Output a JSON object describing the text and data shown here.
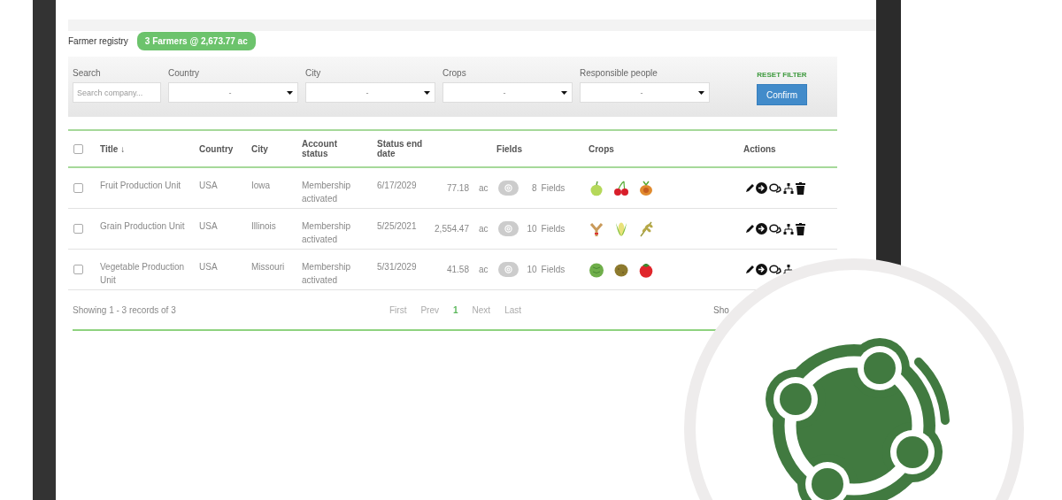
{
  "header": {
    "title": "Farmer registry",
    "summary_badge": "3 Farmers @ 2,673.77 ac"
  },
  "filters": {
    "search": {
      "label": "Search",
      "placeholder": "Search company..."
    },
    "selects": [
      {
        "label": "Country",
        "value": "-"
      },
      {
        "label": "City",
        "value": "-"
      },
      {
        "label": "Crops",
        "value": "-"
      },
      {
        "label": "Responsible people",
        "value": "-"
      }
    ],
    "reset_link": "RESET FILTER",
    "confirm_button": "Confirm"
  },
  "table": {
    "select_all_checked": false,
    "columns": [
      "Title ↓",
      "Country",
      "City",
      "Account status",
      "Status end date",
      "Fields",
      "Crops",
      "Actions"
    ],
    "rows": [
      {
        "checked": false,
        "title": "Fruit Production Unit",
        "country": "USA",
        "city": "Iowa",
        "account_status": "Membership activated",
        "status_end_date": "6/17/2029",
        "acres": "77.18",
        "unit": "ac",
        "field_count": "8",
        "fields_label": "Fields",
        "crops": [
          {
            "kind": "apple"
          },
          {
            "kind": "cherry"
          },
          {
            "kind": "peach"
          }
        ]
      },
      {
        "checked": false,
        "title": "Grain Production Unit",
        "country": "USA",
        "city": "Illinois",
        "account_status": "Membership activated",
        "status_end_date": "5/25/2021",
        "acres": "2,554.47",
        "unit": "ac",
        "field_count": "10",
        "fields_label": "Fields",
        "crops": [
          {
            "kind": "wheat"
          },
          {
            "kind": "corn"
          },
          {
            "kind": "barley"
          }
        ]
      },
      {
        "checked": false,
        "title": "Vegetable Production Unit",
        "country": "USA",
        "city": "Missouri",
        "account_status": "Membership activated",
        "status_end_date": "5/31/2029",
        "acres": "41.58",
        "unit": "ac",
        "field_count": "10",
        "fields_label": "Fields",
        "crops": [
          {
            "kind": "lettuce"
          },
          {
            "kind": "potato"
          },
          {
            "kind": "tomato"
          }
        ]
      }
    ],
    "summary": "Showing 1 - 3 records of 3",
    "pagination": [
      {
        "label": "First",
        "selected": false
      },
      {
        "label": "Prev",
        "selected": false
      },
      {
        "label": "1",
        "selected": true
      },
      {
        "label": "Next",
        "selected": false
      },
      {
        "label": "Last",
        "selected": false
      }
    ],
    "page_size_label": "Sho"
  }
}
